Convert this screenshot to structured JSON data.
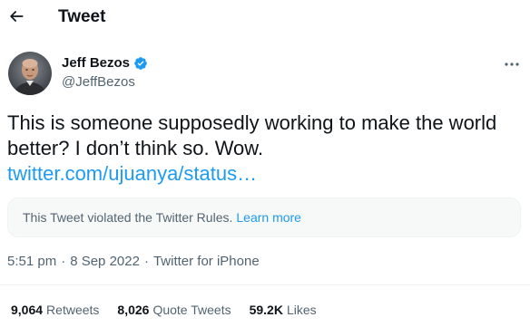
{
  "header": {
    "title": "Tweet"
  },
  "author": {
    "name": "Jeff Bezos",
    "handle": "@JeffBezos",
    "verified": true
  },
  "tweet": {
    "text": "This is someone supposedly working to make the world better? I don’t think so. Wow.",
    "link": "twitter.com/ujuanya/status…"
  },
  "notice": {
    "text": "This Tweet violated the Twitter Rules.",
    "learn_more": "Learn more"
  },
  "meta": {
    "time": "5:51 pm",
    "separator": "·",
    "date": "8 Sep 2022",
    "source": "Twitter for iPhone"
  },
  "stats": {
    "retweets_count": "9,064",
    "retweets_label": "Retweets",
    "quotes_count": "8,026",
    "quotes_label": "Quote Tweets",
    "likes_count": "59.2K",
    "likes_label": "Likes"
  },
  "colors": {
    "link": "#1d9bf0",
    "secondary_text": "#536471",
    "primary_text": "#0f1419",
    "notice_bg": "#f7f9f9"
  }
}
